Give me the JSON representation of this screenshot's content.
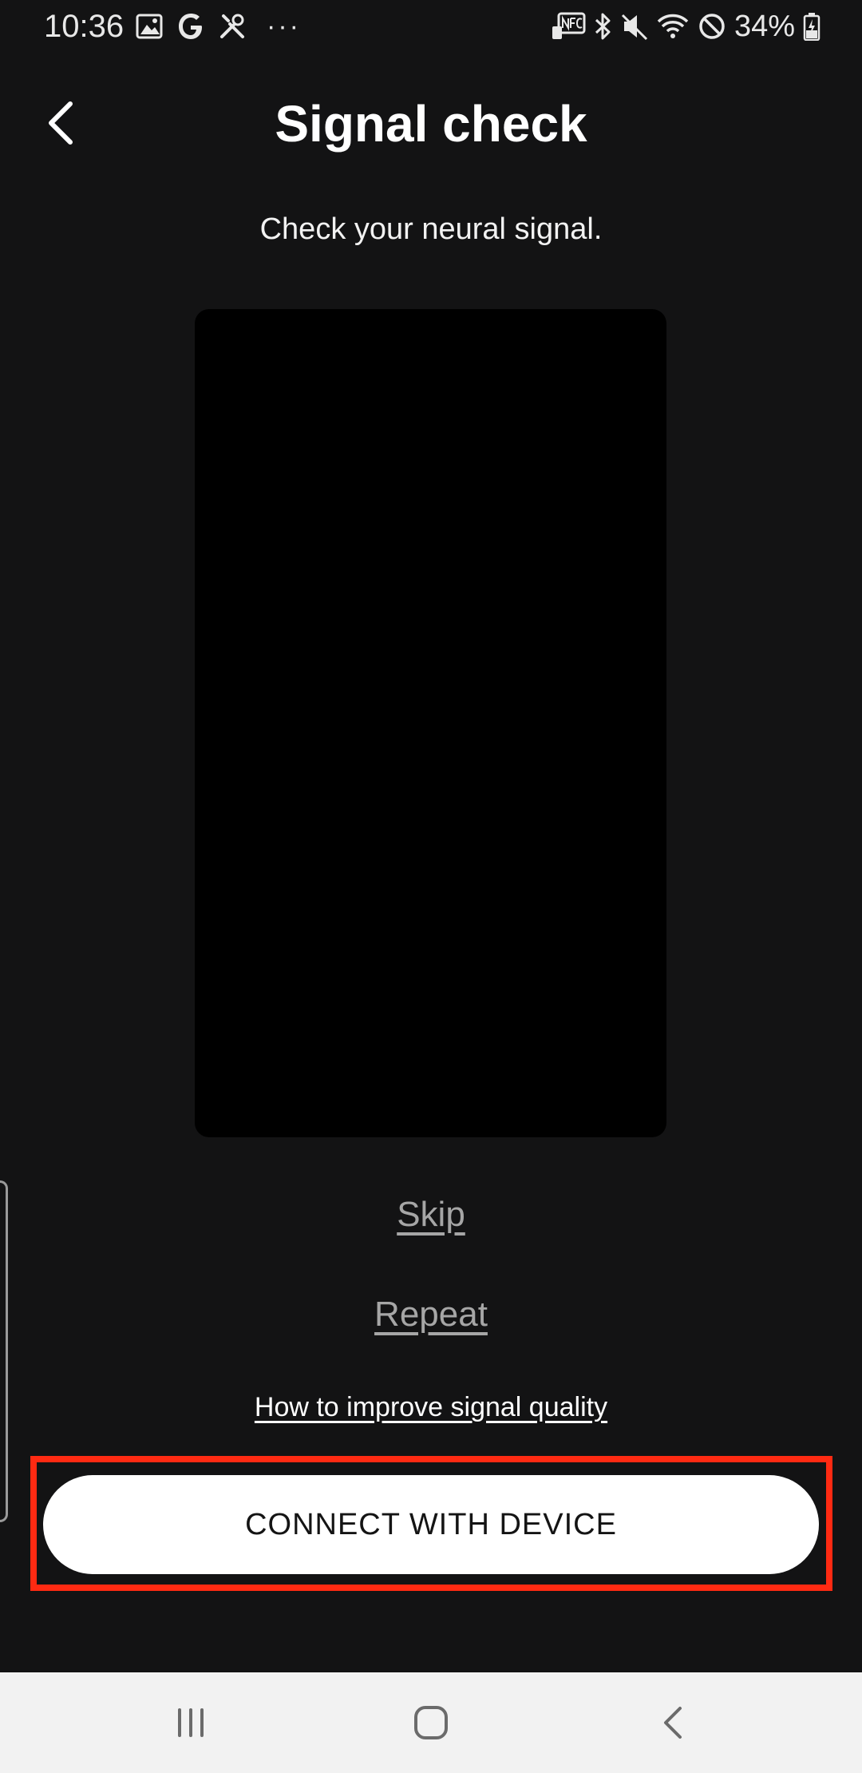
{
  "status_bar": {
    "time": "10:36",
    "battery": "34%",
    "left_icons": [
      "gallery-icon",
      "google-icon",
      "tools-icon",
      "more-dots-icon"
    ],
    "right_icons": [
      "nfc-icon",
      "bluetooth-icon",
      "mute-icon",
      "wifi-icon",
      "do-not-disturb-icon",
      "battery-icon"
    ],
    "more_label": "···"
  },
  "header": {
    "title": "Signal check",
    "back_icon": "chevron-left-icon"
  },
  "main": {
    "subtitle": "Check your neural signal.",
    "skip_label": "Skip",
    "repeat_label": "Repeat",
    "improve_link": "How to improve signal quality",
    "connect_button": "CONNECT WITH DEVICE"
  },
  "colors": {
    "background": "#131314",
    "preview": "#000000",
    "highlight": "#ff2a12",
    "button_bg": "#ffffff",
    "link_muted": "#a6a6a6",
    "nav_bar": "#f2f2f2"
  },
  "nav_bar": {
    "icons": [
      "recent-apps-icon",
      "home-icon",
      "back-icon"
    ]
  }
}
